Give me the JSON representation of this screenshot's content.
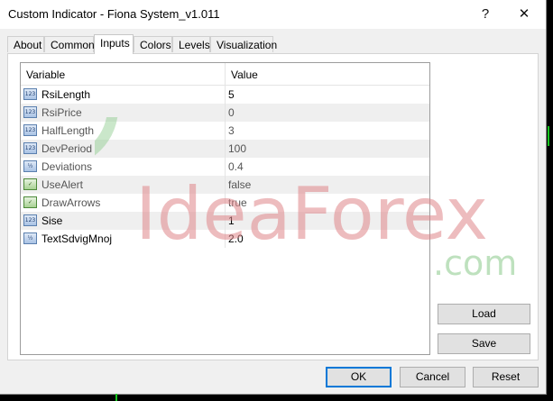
{
  "window": {
    "title": "Custom Indicator - Fiona System_v1.011",
    "help_label": "?",
    "close_label": "✕"
  },
  "tabs": [
    {
      "label": "About"
    },
    {
      "label": "Common"
    },
    {
      "label": "Inputs"
    },
    {
      "label": "Colors"
    },
    {
      "label": "Levels"
    },
    {
      "label": "Visualization"
    }
  ],
  "grid": {
    "col_variable": "Variable",
    "col_value": "Value",
    "rows": [
      {
        "name": "RsiLength",
        "value": "5",
        "type": "123"
      },
      {
        "name": "RsiPrice",
        "value": "0",
        "type": "123"
      },
      {
        "name": "HalfLength",
        "value": "3",
        "type": "123"
      },
      {
        "name": "DevPeriod",
        "value": "100",
        "type": "123"
      },
      {
        "name": "Deviations",
        "value": "0.4",
        "type": "1/2"
      },
      {
        "name": "UseAlert",
        "value": "false",
        "type": "bool"
      },
      {
        "name": "DrawArrows",
        "value": "true",
        "type": "bool"
      },
      {
        "name": "Sise",
        "value": "1",
        "type": "123"
      },
      {
        "name": "TextSdvigMnoj",
        "value": "2.0",
        "type": "1/2"
      }
    ]
  },
  "watermark": {
    "brand": "IdeaForex",
    "suffix": ".com"
  },
  "buttons": {
    "load": "Load",
    "save": "Save",
    "ok": "OK",
    "cancel": "Cancel",
    "reset": "Reset"
  },
  "colors": {
    "accent": "#0078d7",
    "watermark_red": "#e0868a",
    "watermark_green": "#8ac98a"
  }
}
